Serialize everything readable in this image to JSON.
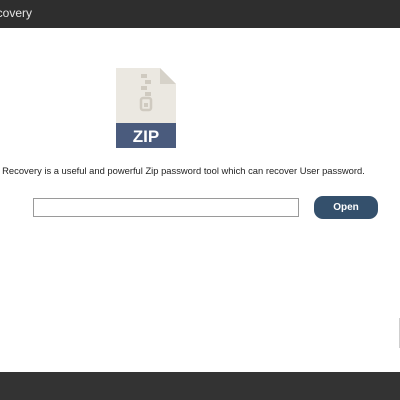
{
  "window": {
    "title": "ecovery"
  },
  "main": {
    "icon_name": "zip-file-icon",
    "icon_label": "ZIP",
    "description": "ord Recovery is a useful and powerful Zip password tool which can recover User password.",
    "file_input": {
      "value": "",
      "placeholder": ""
    },
    "open_label": "Open"
  },
  "colors": {
    "titlebar": "#2e2e2e",
    "bottombar": "#333333",
    "button": "#34506c",
    "icon_band": "#4a5b7d",
    "icon_page": "#ebe8e1"
  }
}
